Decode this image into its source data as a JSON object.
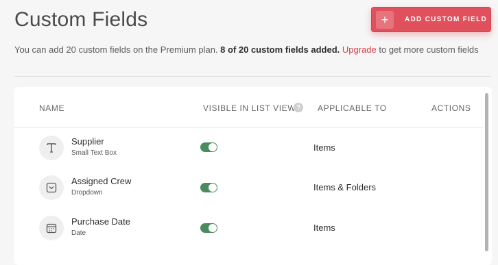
{
  "header": {
    "title": "Custom Fields",
    "add_button_label": "ADD CUSTOM FIELD",
    "add_button_icon": "plus-icon"
  },
  "info": {
    "text_prefix": "You can add 20 custom fields on the Premium plan.",
    "count_text": "8 of 20 custom fields added.",
    "upgrade_link": "Upgrade",
    "text_suffix": "to get more custom fields"
  },
  "table": {
    "columns": {
      "name": "NAME",
      "visible": "VISIBLE IN LIST VIEW",
      "applicable": "APPLICABLE TO",
      "actions": "ACTIONS"
    },
    "rows": [
      {
        "name": "Supplier",
        "type": "Small Text Box",
        "icon": "text-icon",
        "visible": true,
        "applicable_to": "Items"
      },
      {
        "name": "Assigned Crew",
        "type": "Dropdown",
        "icon": "dropdown-icon",
        "visible": true,
        "applicable_to": "Items & Folders"
      },
      {
        "name": "Purchase Date",
        "type": "Date",
        "icon": "calendar-icon",
        "visible": true,
        "applicable_to": "Items"
      }
    ]
  },
  "colors": {
    "accent": "#e0505d",
    "toggle_on": "#4a8c5c",
    "link": "#d9404d"
  }
}
